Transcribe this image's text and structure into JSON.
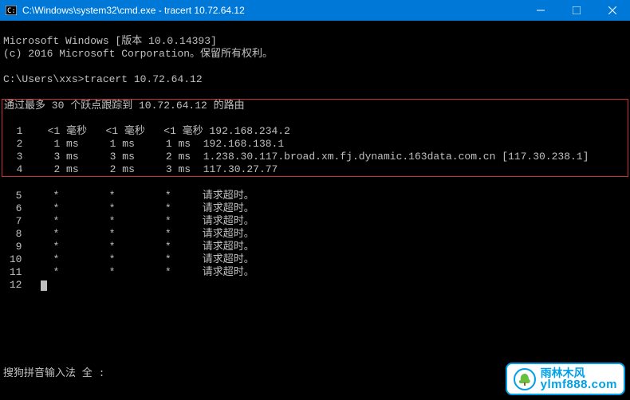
{
  "titlebar": {
    "title": "C:\\Windows\\system32\\cmd.exe - tracert  10.72.64.12"
  },
  "header": {
    "line1": "Microsoft Windows [版本 10.0.14393]",
    "line2": "(c) 2016 Microsoft Corporation。保留所有权利。"
  },
  "prompt": {
    "path": "C:\\Users\\xxs>",
    "command": "tracert 10.72.64.12"
  },
  "trace_header": "通过最多 30 个跃点跟踪到 10.72.64.12 的路由",
  "hops_highlighted": [
    {
      "n": "1",
      "t1": "<1 毫秒",
      "t2": "<1 毫秒",
      "t3": "<1 毫秒",
      "host": "192.168.234.2"
    },
    {
      "n": "2",
      "t1": "1 ms",
      "t2": "1 ms",
      "t3": "1 ms",
      "host": "192.168.138.1"
    },
    {
      "n": "3",
      "t1": "3 ms",
      "t2": "3 ms",
      "t3": "2 ms",
      "host": "1.238.30.117.broad.xm.fj.dynamic.163data.com.cn [117.30.238.1]"
    },
    {
      "n": "4",
      "t1": "2 ms",
      "t2": "2 ms",
      "t3": "3 ms",
      "host": "117.30.27.77"
    }
  ],
  "hops_timeout": [
    {
      "n": "5",
      "t1": "*",
      "t2": "*",
      "t3": "*",
      "host": "请求超时。"
    },
    {
      "n": "6",
      "t1": "*",
      "t2": "*",
      "t3": "*",
      "host": "请求超时。"
    },
    {
      "n": "7",
      "t1": "*",
      "t2": "*",
      "t3": "*",
      "host": "请求超时。"
    },
    {
      "n": "8",
      "t1": "*",
      "t2": "*",
      "t3": "*",
      "host": "请求超时。"
    },
    {
      "n": "9",
      "t1": "*",
      "t2": "*",
      "t3": "*",
      "host": "请求超时。"
    },
    {
      "n": "10",
      "t1": "*",
      "t2": "*",
      "t3": "*",
      "host": "请求超时。"
    },
    {
      "n": "11",
      "t1": "*",
      "t2": "*",
      "t3": "*",
      "host": "请求超时。"
    }
  ],
  "pending_hop": "12",
  "ime": "搜狗拼音输入法 全 :",
  "watermark": {
    "cn": "雨林木风",
    "url": "ylmf888.com"
  }
}
